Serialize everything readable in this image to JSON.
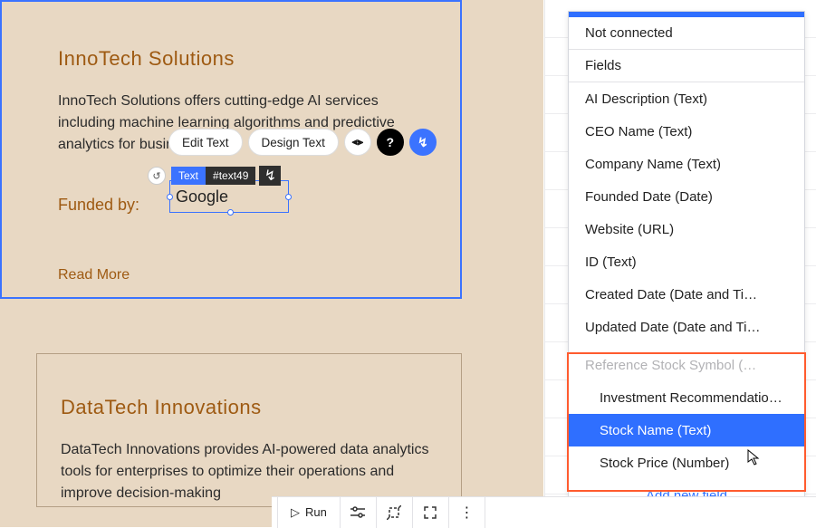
{
  "card1": {
    "title": "InnoTech Solutions",
    "desc": "InnoTech Solutions offers cutting-edge AI services including machine learning algorithms and predictive analytics for businesses.",
    "funded_label": "Funded by:",
    "funded_value": "Google",
    "readmore": "Read More"
  },
  "card2": {
    "title": "DataTech Innovations",
    "desc": "DataTech Innovations provides AI-powered data analytics tools for enterprises to optimize their operations and improve decision-making"
  },
  "selection": {
    "undo_glyph": "↺",
    "tag_type": "Text",
    "tag_id": "#text49",
    "tag_ai_glyph": "↯"
  },
  "pillbar": {
    "edit": "Edit Text",
    "design": "Design Text",
    "stretch_glyph": "⫷⫸",
    "help_glyph": "?",
    "ai_glyph": "↯"
  },
  "dropdown": {
    "not_connected": "Not connected",
    "fields_header": "Fields",
    "items": [
      "AI Description (Text)",
      "CEO Name (Text)",
      "Company Name (Text)",
      "Founded Date (Date)",
      "Website (URL)",
      "ID (Text)",
      "Created Date (Date and Ti…",
      "Updated Date (Date and Ti…"
    ],
    "ref_header": "Reference Stock Symbol (…",
    "sub_items": [
      "Investment Recommendatio…",
      "Stock Name (Text)",
      "Stock Price (Number)"
    ],
    "add_new": "Add new field"
  },
  "bottombar": {
    "run": "Run",
    "play_glyph": "▷",
    "sliders_glyph": "⚙",
    "crop_glyph": "⤢",
    "expand_glyph": "⤡",
    "more_glyph": "⋮"
  },
  "cursor_glyph": "↖"
}
